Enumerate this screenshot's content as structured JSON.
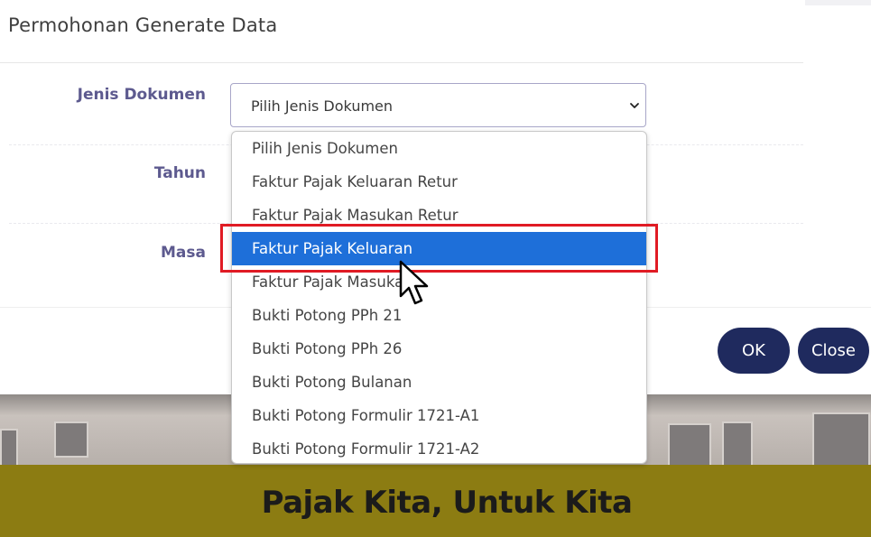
{
  "modal": {
    "title": "Permohonan Generate Data",
    "labels": {
      "jenis_dokumen": "Jenis Dokumen",
      "tahun": "Tahun",
      "masa": "Masa"
    },
    "select": {
      "value": "Pilih Jenis Dokumen",
      "icon": "chevron-down-icon"
    },
    "dropdown": {
      "options": [
        "Pilih Jenis Dokumen",
        "Faktur Pajak Keluaran Retur",
        "Faktur Pajak Masukan Retur",
        "Faktur Pajak Keluaran",
        "Faktur Pajak Masukan",
        "Bukti Potong PPh 21",
        "Bukti Potong PPh 26",
        "Bukti Potong Bulanan",
        "Bukti Potong Formulir 1721-A1",
        "Bukti Potong Formulir 1721-A2"
      ],
      "highlighted_index": 3
    },
    "buttons": {
      "ok": "OK",
      "close": "Close"
    }
  },
  "banner": {
    "text": "Pajak Kita, Untuk Kita"
  },
  "colors": {
    "highlight": "#1e6fd9",
    "annotation_box": "#e01b24",
    "button": "#1f2a5e",
    "banner": "#8c7c12",
    "label": "#5d5a8f"
  }
}
